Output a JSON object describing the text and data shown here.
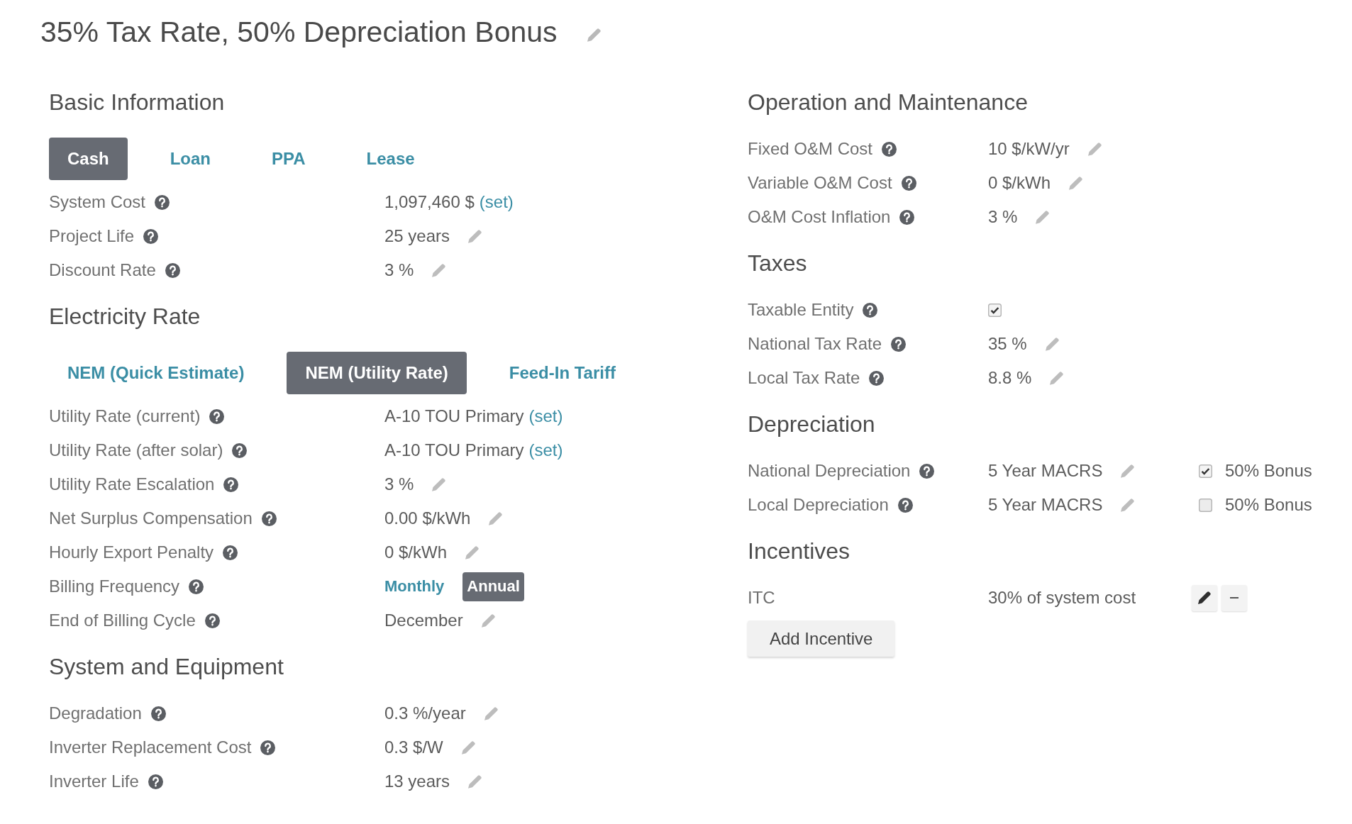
{
  "title": "35% Tax Rate, 50% Depreciation Bonus",
  "left_column": [
    {
      "heading": "Basic Information",
      "tabs": [
        {
          "label": "Cash",
          "selected": true
        },
        {
          "label": "Loan",
          "selected": false
        },
        {
          "label": "PPA",
          "selected": false
        },
        {
          "label": "Lease",
          "selected": false
        }
      ],
      "rows": [
        {
          "label": "System Cost",
          "help": true,
          "kind": "link",
          "value": "1,097,460 $",
          "link": "(set)"
        },
        {
          "label": "Project Life",
          "help": true,
          "kind": "edit",
          "value": "25 years"
        },
        {
          "label": "Discount Rate",
          "help": true,
          "kind": "edit",
          "value": "3 %"
        }
      ]
    },
    {
      "heading": "Electricity Rate",
      "tabs": [
        {
          "label": "NEM (Quick Estimate)",
          "selected": false
        },
        {
          "label": "NEM (Utility Rate)",
          "selected": true
        },
        {
          "label": "Feed-In Tariff",
          "selected": false
        }
      ],
      "rows": [
        {
          "label": "Utility Rate (current)",
          "help": true,
          "kind": "link",
          "value": "A-10 TOU Primary",
          "link": "(set)"
        },
        {
          "label": "Utility Rate (after solar)",
          "help": true,
          "kind": "link",
          "value": "A-10 TOU Primary",
          "link": "(set)"
        },
        {
          "label": "Utility Rate Escalation",
          "help": true,
          "kind": "edit",
          "value": "3 %"
        },
        {
          "label": "Net Surplus Compensation",
          "help": true,
          "kind": "edit",
          "value": "0.00 $/kWh"
        },
        {
          "label": "Hourly Export Penalty",
          "help": true,
          "kind": "edit",
          "value": "0 $/kWh"
        },
        {
          "label": "Billing Frequency",
          "help": true,
          "kind": "choice",
          "options": [
            {
              "label": "Monthly",
              "selected": false
            },
            {
              "label": "Annual",
              "selected": true
            }
          ]
        },
        {
          "label": "End of Billing Cycle",
          "help": true,
          "kind": "edit",
          "value": "December"
        }
      ]
    },
    {
      "heading": "System and Equipment",
      "rows": [
        {
          "label": "Degradation",
          "help": true,
          "kind": "edit",
          "value": "0.3 %/year"
        },
        {
          "label": "Inverter Replacement Cost",
          "help": true,
          "kind": "edit",
          "value": "0.3 $/W"
        },
        {
          "label": "Inverter Life",
          "help": true,
          "kind": "edit",
          "value": "13 years"
        }
      ]
    }
  ],
  "right_column": [
    {
      "heading": "Operation and Maintenance",
      "rows": [
        {
          "label": "Fixed O&M Cost",
          "help": true,
          "kind": "edit",
          "value": "10 $/kW/yr"
        },
        {
          "label": "Variable O&M Cost",
          "help": true,
          "kind": "edit",
          "value": "0 $/kWh"
        },
        {
          "label": "O&M Cost Inflation",
          "help": true,
          "kind": "edit",
          "value": "3 %"
        }
      ]
    },
    {
      "heading": "Taxes",
      "rows": [
        {
          "label": "Taxable Entity",
          "help": true,
          "kind": "checkbox",
          "checked": true
        },
        {
          "label": "National Tax Rate",
          "help": true,
          "kind": "edit",
          "value": "35 %"
        },
        {
          "label": "Local Tax Rate",
          "help": true,
          "kind": "edit",
          "value": "8.8 %"
        }
      ]
    },
    {
      "heading": "Depreciation",
      "rows": [
        {
          "label": "National Depreciation",
          "help": true,
          "kind": "depreciation",
          "value": "5 Year MACRS",
          "bonus": {
            "label": "50% Bonus",
            "checked": true
          }
        },
        {
          "label": "Local Depreciation",
          "help": true,
          "kind": "depreciation",
          "value": "5 Year MACRS",
          "bonus": {
            "label": "50% Bonus",
            "checked": false
          }
        }
      ]
    },
    {
      "heading": "Incentives",
      "rows": [
        {
          "label": "ITC",
          "help": false,
          "kind": "incentive",
          "value": "30% of system cost"
        }
      ],
      "button": "Add Incentive"
    }
  ]
}
